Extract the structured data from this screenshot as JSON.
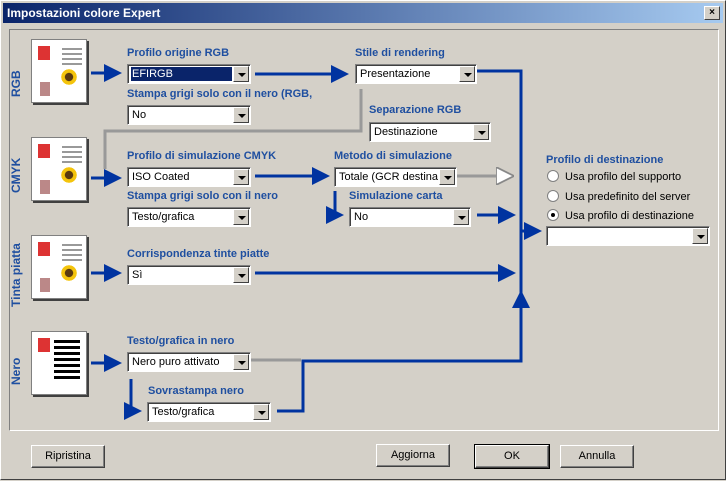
{
  "window": {
    "title": "Impostazioni colore Expert",
    "close_glyph": "×"
  },
  "sections": {
    "rgb": "RGB",
    "cmyk": "CMYK",
    "spot": "Tinta piatta",
    "black": "Nero"
  },
  "rgb": {
    "source_profile_label": "Profilo origine RGB",
    "source_profile_value": "EFIRGB",
    "gray_black_label": "Stampa grigi solo con il nero (RGB,",
    "gray_black_value": "No",
    "rendering_label": "Stile di rendering",
    "rendering_value": "Presentazione",
    "separation_label": "Separazione RGB",
    "separation_value": "Destinazione"
  },
  "cmyk": {
    "sim_profile_label": "Profilo di simulazione CMYK",
    "sim_profile_value": "ISO Coated",
    "sim_method_label": "Metodo di simulazione",
    "sim_method_value": "Totale (GCR destinaz",
    "gray_black_label": "Stampa grigi solo con il nero",
    "gray_black_value": "Testo/grafica",
    "paper_sim_label": "Simulazione carta",
    "paper_sim_value": "No"
  },
  "spot": {
    "match_label": "Corrispondenza tinte piatte",
    "match_value": "Sì"
  },
  "black": {
    "text_graphics_label": "Testo/grafica in nero",
    "text_graphics_value": "Nero puro attivato",
    "overprint_label": "Sovrastampa nero",
    "overprint_value": "Testo/grafica"
  },
  "destination": {
    "label": "Profilo di destinazione",
    "options": [
      "Usa profilo del supporto",
      "Usa predefinito del server",
      "Usa profilo di destinazione"
    ],
    "selected_index": 2,
    "value": ""
  },
  "buttons": {
    "reset": "Ripristina",
    "update": "Aggiorna",
    "ok": "OK",
    "cancel": "Annulla"
  },
  "colors": {
    "accent": "#1f4fa0",
    "flow": "#0033a0",
    "title_start": "#0a246a"
  }
}
